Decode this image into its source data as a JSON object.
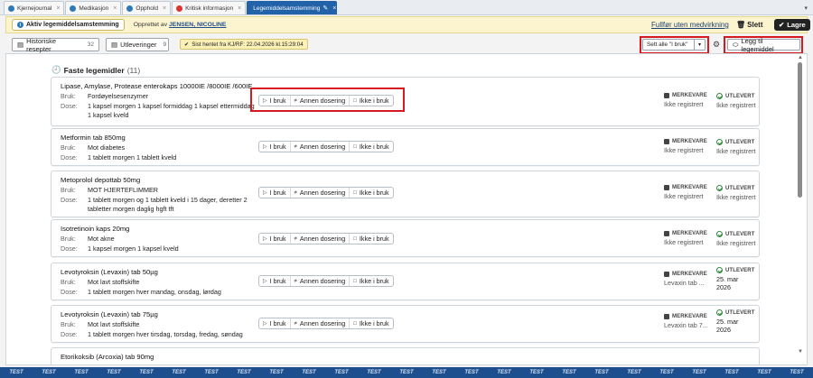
{
  "tabs": [
    {
      "label": "Kjernejournal",
      "icon": "journal-icon"
    },
    {
      "label": "Medikasjon",
      "icon": "medication-icon"
    },
    {
      "label": "Opphold",
      "icon": "stay-icon"
    },
    {
      "label": "Kritisk informasjon",
      "icon": "critical-info-icon"
    },
    {
      "label": "Legemiddelsamstemming",
      "icon": "edit-icon",
      "active": true
    }
  ],
  "header": {
    "status_label": "Aktiv legemiddelsamstemming",
    "created_prefix": "Opprettet av",
    "created_by": "JENSEN, NICOLINE",
    "finish_label": "Fullfør uten medvirkning",
    "delete_label": "Slett",
    "save_label": "Lagre"
  },
  "toolbar": {
    "historic_label": "Historiske resepter",
    "historic_count": "32",
    "dispensing_label": "Utleveringer",
    "dispensing_count": "9",
    "fetched_text": "Sist hentet fra KJ/RF: 22.04.2026 kl.15:29:04",
    "set_all_label": "Sett alle \"I bruk\"",
    "add_label": "Legg til legemiddel"
  },
  "section": {
    "title": "Faste legemidler",
    "count": "(11)"
  },
  "labels": {
    "use": "Bruk:",
    "dose": "Dose:",
    "opt_in_use": "I bruk",
    "opt_other_dose": "Annen dosering",
    "opt_not_in_use": "Ikke i bruk",
    "merkevare": "MERKEVARE",
    "utlevert": "UTLEVERT"
  },
  "medications": [
    {
      "name": "Lipase, Amylase, Protease enterokaps 10000IE /8000IE /600IE",
      "use": "Fordøyelsesenzymer",
      "dose": "1 kapsel morgen 1 kapsel formiddag 1 kapsel ettermiddag 1 kapsel kveld",
      "brand": "Ikke registrert",
      "dispensed": "Ikke registrert"
    },
    {
      "name": "Metformin tab 850mg",
      "use": "Mot diabetes",
      "dose": "1 tablett morgen 1 tablett kveld",
      "brand": "Ikke registrert",
      "dispensed": "Ikke registrert"
    },
    {
      "name": "Metoprolol depottab 50mg",
      "use": "MOT HJERTEFLIMMER",
      "dose": "1 tablett morgen og 1 tablett kveld i 15 dager, deretter 2 tabletter morgen daglig hgft tft",
      "brand": "Ikke registrert",
      "dispensed": "Ikke registrert"
    },
    {
      "name": "Isotretinoin kaps 20mg",
      "use": "Mot akne",
      "dose": "1 kapsel morgen 1 kapsel kveld",
      "brand": "Ikke registrert",
      "dispensed": "Ikke registrert"
    },
    {
      "name": "Levotyroksin (Levaxin) tab 50µg",
      "use": "Mot lavt stoffskifte",
      "dose": "1 tablett morgen hver mandag, onsdag, lørdag",
      "brand": "Levaxin tab ...",
      "dispensed": "25. mar 2026"
    },
    {
      "name": "Levotyroksin (Levaxin) tab 75µg",
      "use": "Mot lavt stoffskifte",
      "dose": "1 tablett morgen hver tirsdag, torsdag, fredag, søndag",
      "brand": "Levaxin tab 7...",
      "dispensed": "25. mar 2026"
    },
    {
      "name": "Etorikoksib (Arcoxia) tab 90mg"
    }
  ],
  "watermark": "TEST",
  "colors": {
    "active_tab": "#2162a8",
    "header_bg": "#fbf4cf",
    "highlight": "#d71920",
    "dispensed_icon": "#2e8b3e"
  }
}
